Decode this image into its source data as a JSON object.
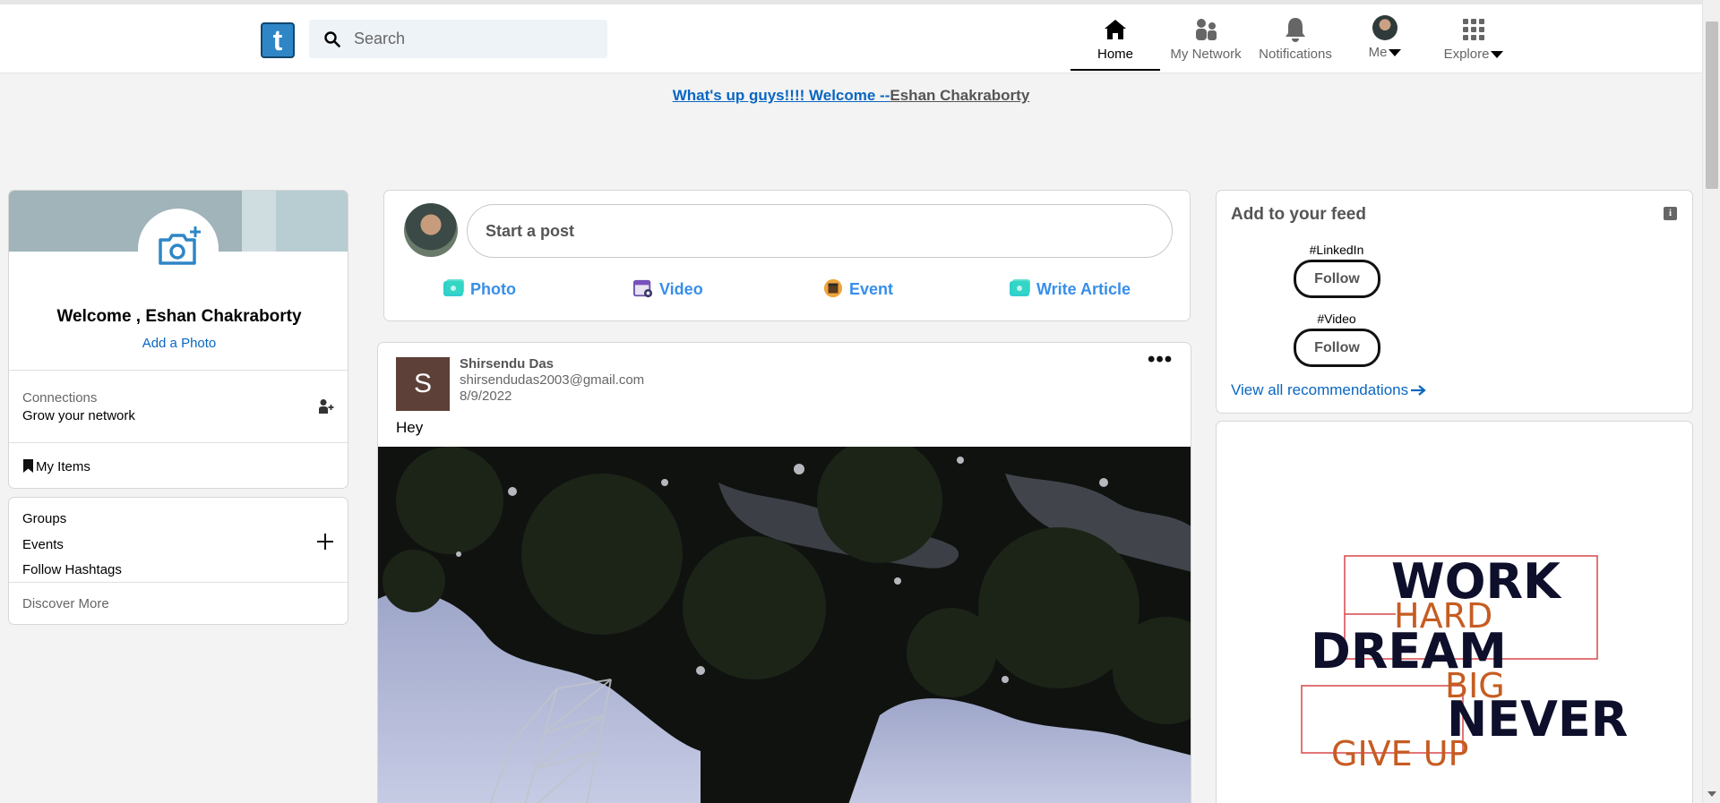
{
  "nav": {
    "logo_letter": "t",
    "search_placeholder": "Search",
    "items": [
      {
        "label": "Home",
        "icon": "home-icon"
      },
      {
        "label": "My Network",
        "icon": "people-icon"
      },
      {
        "label": "Notifications",
        "icon": "bell-icon"
      },
      {
        "label": "Me",
        "icon": "avatar"
      },
      {
        "label": "Explore",
        "icon": "grid-icon"
      }
    ]
  },
  "banner": {
    "part1": "What's up guys!!!! Welcome --",
    "part2": "Eshan Chakraborty"
  },
  "profile": {
    "name": "Welcome , Eshan Chakraborty",
    "add_photo": "Add a Photo",
    "connections_label": "Connections",
    "connections_sub": "Grow your network",
    "my_items": "My Items"
  },
  "groups": {
    "items": [
      "Groups",
      "Events",
      "Follow Hashtags"
    ],
    "discover": "Discover More"
  },
  "composer": {
    "placeholder": "Start a post",
    "actions": [
      {
        "label": "Photo",
        "color": "#2fcfcf"
      },
      {
        "label": "Video",
        "color": "#7a4fbf"
      },
      {
        "label": "Event",
        "color": "#e7a33e"
      },
      {
        "label": "Write Article",
        "color": "#2fcfcf"
      }
    ]
  },
  "post": {
    "avatar_letter": "S",
    "author": "Shirsendu Das",
    "email": "shirsendudas2003@gmail.com",
    "date": "8/9/2022",
    "text": "Hey",
    "menu": "•••"
  },
  "feed": {
    "title": "Add to your feed",
    "info": "i",
    "recommendations": [
      {
        "tag": "#LinkedIn",
        "button": "Follow"
      },
      {
        "tag": "#Video",
        "button": "Follow"
      }
    ],
    "view_all": "View all recommendations"
  },
  "quote": {
    "words": [
      "WORK",
      "HARD",
      "DREAM",
      "BIG",
      "NEVER",
      "GIVE UP"
    ]
  },
  "colors": {
    "brand": "#0a66c2",
    "action": "#378fe9",
    "quote_dark": "#0d0f2b",
    "quote_accent": "#c65c22"
  }
}
